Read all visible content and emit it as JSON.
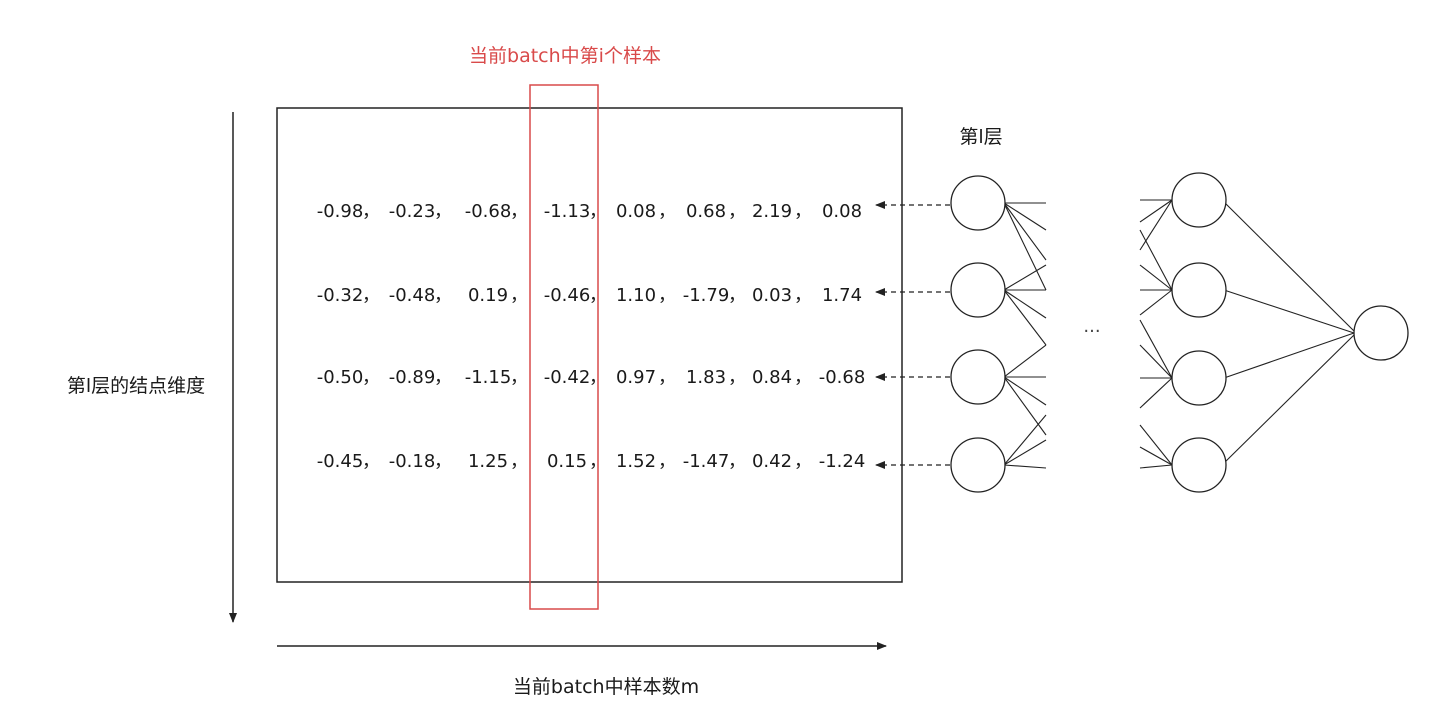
{
  "title_highlight": "当前batch中第i个样本",
  "layer_label": "第l层",
  "y_axis_label": "第l层的结点维度",
  "x_axis_label": "当前batch中样本数m",
  "ellipsis": "···",
  "separator": "，",
  "matrix": [
    [
      "-0.98",
      "-0.23",
      "-0.68",
      "-1.13",
      "0.08",
      "0.68",
      "2.19",
      "0.08"
    ],
    [
      "-0.32",
      "-0.48",
      "0.19",
      "-0.46",
      "1.10",
      "-1.79",
      "0.03",
      "1.74"
    ],
    [
      "-0.50",
      "-0.89",
      "-1.15",
      "-0.42",
      "0.97",
      "1.83",
      "0.84",
      "-0.68"
    ],
    [
      "-0.45",
      "-0.18",
      "1.25",
      "0.15",
      "1.52",
      "-1.47",
      "0.42",
      "-1.24"
    ]
  ],
  "highlight_column_index": 3,
  "colors": {
    "highlight": "#d94a4a",
    "stroke": "#222222",
    "text": "#1a1a1a"
  }
}
